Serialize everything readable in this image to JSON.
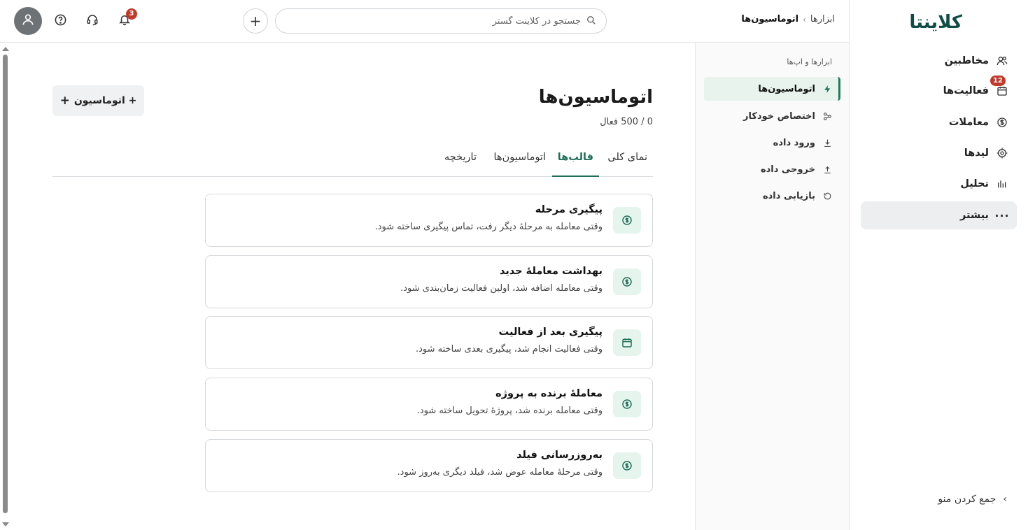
{
  "brand": {
    "logo_text": "کلاینتا",
    "accent_color": "#1f6f58"
  },
  "sidebar": {
    "items": [
      {
        "label": "مخاطبین",
        "icon": "users-icon"
      },
      {
        "label": "فعالیت‌ها",
        "icon": "calendar-icon",
        "badge": "12"
      },
      {
        "label": "معاملات",
        "icon": "dollar-circle-icon"
      },
      {
        "label": "لیدها",
        "icon": "target-icon"
      },
      {
        "label": "تحلیل",
        "icon": "bar-chart-icon"
      },
      {
        "label": "بیشتر",
        "icon": "more-dots-icon",
        "active": true
      }
    ],
    "collapse_label": "جمع کردن منو"
  },
  "header": {
    "breadcrumb": {
      "parent": "ابزارها",
      "current": "اتوماسیون‌ها"
    },
    "search": {
      "placeholder": "جستجو در کلاینت گستر"
    },
    "notifications_count": "3"
  },
  "tools_panel": {
    "heading": "ابزارها و اپ‌ها",
    "items": [
      {
        "label": "اتوماسیون‌ها",
        "icon": "lightning-icon",
        "active": true
      },
      {
        "label": "اختصاص خودکار",
        "icon": "share-nodes-icon"
      },
      {
        "label": "ورود داده",
        "icon": "download-icon"
      },
      {
        "label": "خروجی داده",
        "icon": "upload-icon"
      },
      {
        "label": "بازیابی داده",
        "icon": "restore-icon"
      }
    ]
  },
  "main": {
    "title": "اتوماسیون‌ها",
    "active_count": "0 / 500 فعال",
    "new_button_label": "+ اتوماسیون",
    "tabs": [
      {
        "label": "نمای کلی"
      },
      {
        "label": "قالب‌ها",
        "active": true
      },
      {
        "label": "اتوماسیون‌ها"
      },
      {
        "label": "تاریخچه"
      }
    ],
    "templates": [
      {
        "title": "پیگیری مرحله",
        "description": "وقتی معامله به مرحلهٔ دیگر رفت، تماس پیگیری ساخته شود.",
        "icon": "dollar-circle-icon"
      },
      {
        "title": "بهداشت معاملهٔ جدید",
        "description": "وقتی معامله اضافه شد، اولین فعالیت زمان‌بندی شود.",
        "icon": "dollar-circle-icon"
      },
      {
        "title": "پیگیری بعد از فعالیت",
        "description": "وقتی فعالیت انجام شد، پیگیری بعدی ساخته شود.",
        "icon": "calendar-icon"
      },
      {
        "title": "معاملهٔ برنده به پروژه",
        "description": "وقتی معامله برنده شد، پروژهٔ تحویل ساخته شود.",
        "icon": "dollar-circle-icon"
      },
      {
        "title": "به‌روزرسانی فیلد",
        "description": "وقتی مرحلهٔ معامله عوض شد، فیلد دیگری به‌روز شود.",
        "icon": "dollar-circle-icon"
      }
    ]
  }
}
